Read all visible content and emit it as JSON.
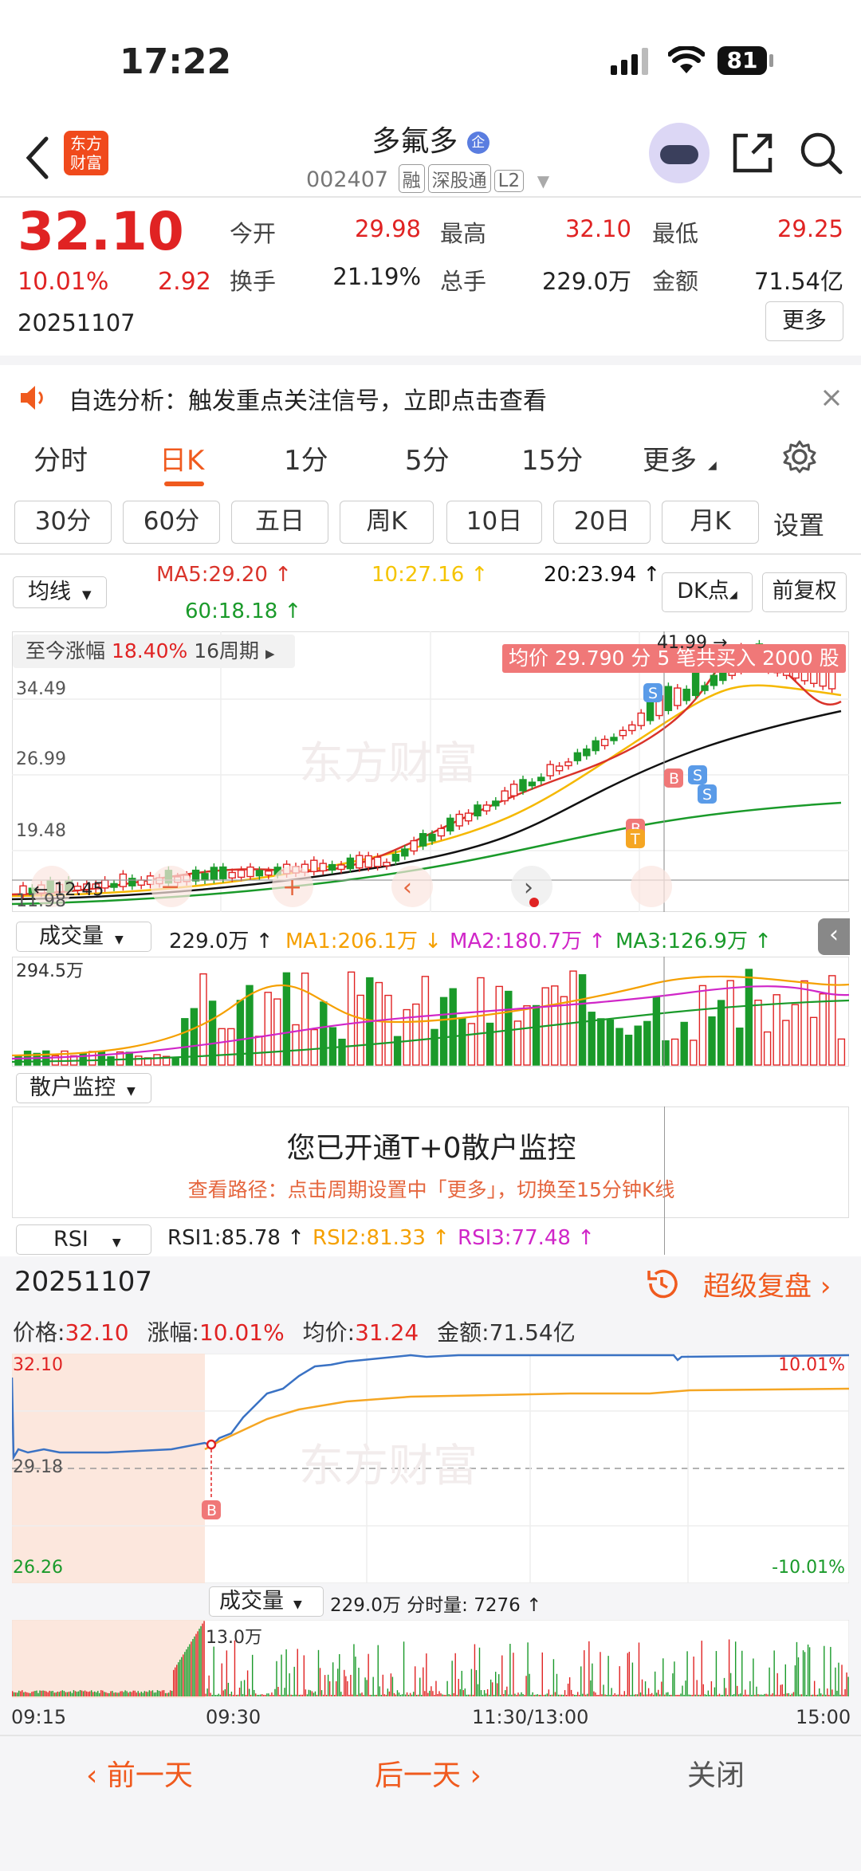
{
  "status": {
    "time": "17:22",
    "battery": "81"
  },
  "header": {
    "logo_line1": "东方",
    "logo_line2": "财富",
    "title": "多氟多",
    "title_badge": "企",
    "code": "002407",
    "tags": [
      "融",
      "深股通",
      "L2"
    ]
  },
  "quote": {
    "price": "32.10",
    "pct": "10.01%",
    "change": "2.92",
    "date": "20251107",
    "open_label": "今开",
    "open": "29.98",
    "high_label": "最高",
    "high": "32.10",
    "low_label": "最低",
    "low": "29.25",
    "turnover_label": "换手",
    "turnover": "21.19%",
    "volume_label": "总手",
    "volume": "229.0万",
    "amount_label": "金额",
    "amount": "71.54亿",
    "more_button": "更多"
  },
  "banner": {
    "text": "自选分析：触发重点关注信号，立即点击查看"
  },
  "tabs": {
    "items": [
      "分时",
      "日K",
      "1分",
      "5分",
      "15分",
      "更多"
    ],
    "active": "日K"
  },
  "subtabs": {
    "items": [
      "30分",
      "60分",
      "五日",
      "周K",
      "10日",
      "20日",
      "月K"
    ],
    "settings": "设置"
  },
  "kline": {
    "indicator_select": "均线",
    "ma5": "MA5:29.20",
    "ma10": "10:27.16",
    "ma20": "20:23.94",
    "ma60": "60:18.18",
    "dk_button": "DK点",
    "fq_button": "前复权",
    "range_label": "至今涨幅",
    "range_pct": "18.40%",
    "range_periods": "16周期",
    "tooltip": "均价 29.790 分 5 笔共买入 2000 股",
    "peak_label": "41.99",
    "low_label": "12.45",
    "y_ticks": [
      "34.49",
      "26.99",
      "19.48",
      "11.98"
    ],
    "watermark": "东方财富"
  },
  "volume": {
    "select": "成交量",
    "value": "229.0万",
    "ma1": "MA1:206.1万",
    "ma2": "MA2:180.7万",
    "ma3": "MA3:126.9万",
    "y_top": "294.5万"
  },
  "retail": {
    "select": "散户监控",
    "title": "您已开通T+0散户监控",
    "hint": "查看路径：点击周期设置中「更多」，切换至15分钟K线"
  },
  "rsi": {
    "select": "RSI",
    "rsi1": "RSI1:85.78",
    "rsi2": "RSI2:81.33",
    "rsi3": "RSI3:77.48"
  },
  "replay": {
    "date": "20251107",
    "link": "超级复盘",
    "price_label": "价格:",
    "price": "32.10",
    "pct_label": "涨幅:",
    "pct": "10.01%",
    "avg_label": "均价:",
    "avg": "31.24",
    "amount_label": "金额:",
    "amount": "71.54亿",
    "y_top": "32.10",
    "y_mid": "29.18",
    "y_bot": "26.26",
    "pct_top": "10.01%",
    "pct_bot": "-10.01%",
    "vol_select": "成交量",
    "vol_value": "229.0万",
    "vol_tick_label": "分时量:",
    "vol_tick": "7276",
    "vol_max": "13.0万",
    "times": [
      "09:15",
      "09:30",
      "11:30/13:00",
      "15:00"
    ],
    "b_marker": "B"
  },
  "footer": {
    "prev": "前一天",
    "next": "后一天",
    "close": "关闭"
  },
  "colors": {
    "up": "#e02323",
    "down": "#1a9a2a",
    "accent": "#f07020",
    "ma5": "#d9332a",
    "ma10": "#f5b800",
    "ma20": "#111111",
    "ma60": "#1a9a2a",
    "avg_line": "#f5a623",
    "price_line": "#3a72c4"
  }
}
